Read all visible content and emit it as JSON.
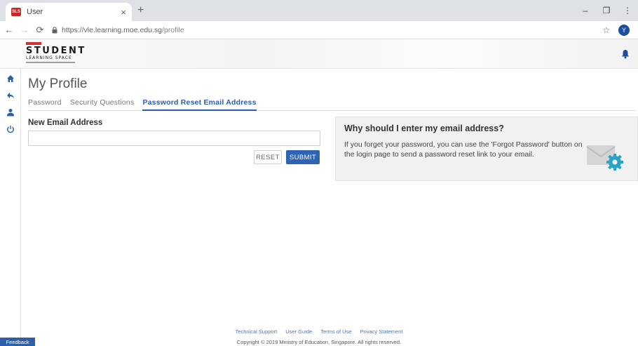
{
  "browser": {
    "tab_title": "User",
    "tab_favicon_text": "SLS",
    "close_glyph": "×",
    "new_tab_glyph": "+",
    "url_host": "https://vle.learning.moe.edu.sg",
    "url_path": "/profile",
    "profile_initial": "Y",
    "minimize_glyph": "–",
    "restore_glyph": "❐",
    "more_glyph": "⋮"
  },
  "header": {
    "logo_line1": "STUDENT",
    "logo_line2": "LEARNING SPACE",
    "brand_color": "#d32f2f"
  },
  "sidebar": {
    "items": [
      {
        "icon": "home-icon"
      },
      {
        "icon": "back-arrow-icon"
      },
      {
        "icon": "user-icon"
      },
      {
        "icon": "power-icon"
      }
    ],
    "accent": "#2f64b4"
  },
  "main": {
    "title": "My Profile",
    "tabs": [
      {
        "label": "Password",
        "active": false
      },
      {
        "label": "Security Questions",
        "active": false
      },
      {
        "label": "Password Reset Email Address",
        "active": true
      }
    ],
    "form": {
      "label": "New Email Address",
      "value": "",
      "placeholder": "",
      "reset_label": "RESET",
      "submit_label": "SUBMIT"
    },
    "info": {
      "title": "Why should I enter my email address?",
      "text": "If you forget your password, you can use the 'Forgot Password' button on the login page to send a password reset link to your email."
    }
  },
  "footer": {
    "links": [
      "Technical Support",
      "User Guide",
      "Terms of Use",
      "Privacy Statement"
    ],
    "copyright": "Copyright © 2019 Ministry of Education, Singapore. All rights reserved.",
    "feedback_label": "Feedback"
  }
}
